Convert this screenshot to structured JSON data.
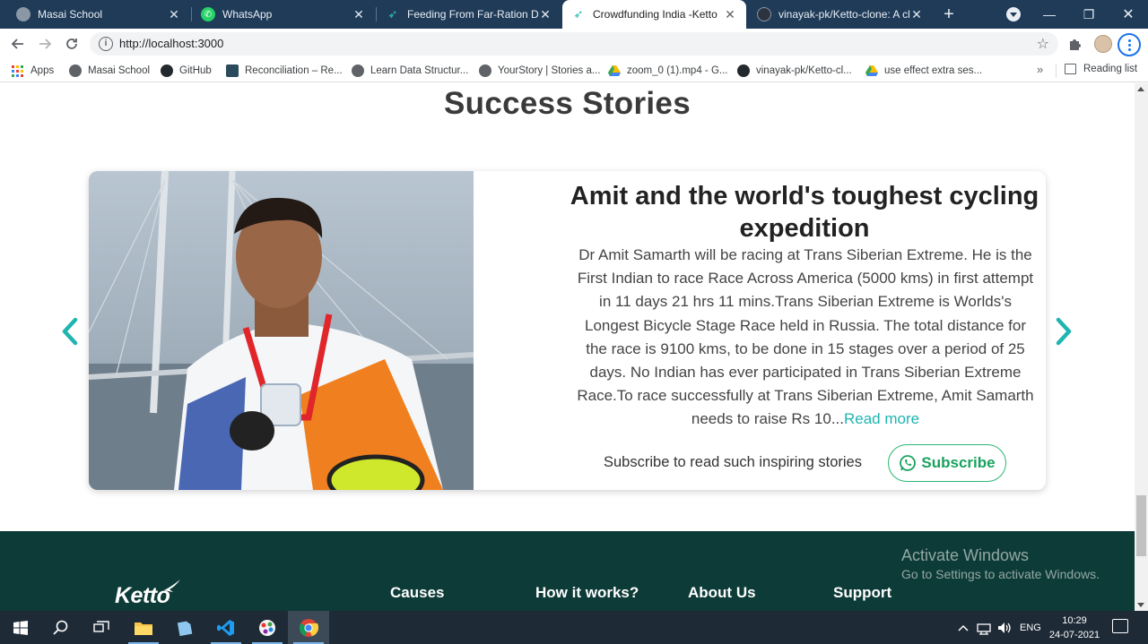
{
  "browser": {
    "tabs": [
      {
        "title": "Masai School",
        "icon": "globe-icon",
        "active": false
      },
      {
        "title": "WhatsApp",
        "icon": "whatsapp-icon",
        "active": false
      },
      {
        "title": "Feeding From Far-Ration Dist",
        "icon": "ketto-icon",
        "active": false
      },
      {
        "title": "Crowdfunding India -Ketto",
        "icon": "ketto-icon",
        "active": true
      },
      {
        "title": "vinayak-pk/Ketto-clone: A clo",
        "icon": "github-icon",
        "active": false
      }
    ],
    "new_tab_label": "+",
    "url": "http://localhost:3000",
    "bookmarks": [
      {
        "label": "Apps",
        "icon": "apps-grid-icon"
      },
      {
        "label": "Masai School",
        "icon": "globe-icon"
      },
      {
        "label": "GitHub",
        "icon": "github-icon"
      },
      {
        "label": "Reconciliation – Re...",
        "icon": "app-icon"
      },
      {
        "label": "Learn Data Structur...",
        "icon": "globe-icon"
      },
      {
        "label": "YourStory | Stories a...",
        "icon": "globe-icon"
      },
      {
        "label": "zoom_0 (1).mp4 - G...",
        "icon": "google-drive-icon"
      },
      {
        "label": "vinayak-pk/Ketto-cl...",
        "icon": "github-icon"
      },
      {
        "label": "use effect extra ses...",
        "icon": "google-drive-icon"
      }
    ],
    "bookmarks_more": "»",
    "reading_list": "Reading list"
  },
  "page": {
    "section_title": "Success Stories",
    "story": {
      "title": "Amit and the world's toughest cycling expedition",
      "description": "Dr Amit Samarth will be racing at Trans Siberian Extreme. He is the First Indian to race Race Across America (5000 kms) in first attempt in 11 days 21 hrs 11 mins.Trans Siberian Extreme is Worlds's Longest Bicycle Stage Race held in Russia. The total distance for the race is 9100 kms, to be done in 15 stages over a period of 25 days. No Indian has ever participated in Trans Siberian Extreme Race.To race successfully at Trans Siberian Extreme, Amit Samarth needs to raise Rs 10...",
      "read_more": "Read more",
      "subscribe_text": "Subscribe to read such inspiring stories",
      "subscribe_button": "Subscribe"
    },
    "footer": {
      "logo": "Ketto",
      "links": [
        "Causes",
        "How it works?",
        "About Us",
        "Support"
      ]
    },
    "watermark": {
      "line1": "Activate Windows",
      "line2": "Go to Settings to activate Windows."
    },
    "colors": {
      "accent_teal": "#1fb5b0",
      "whatsapp_green": "#2bb673",
      "footer_bg": "#0d3b37"
    }
  },
  "taskbar": {
    "language": "ENG",
    "time": "10:29",
    "date": "24-07-2021"
  }
}
